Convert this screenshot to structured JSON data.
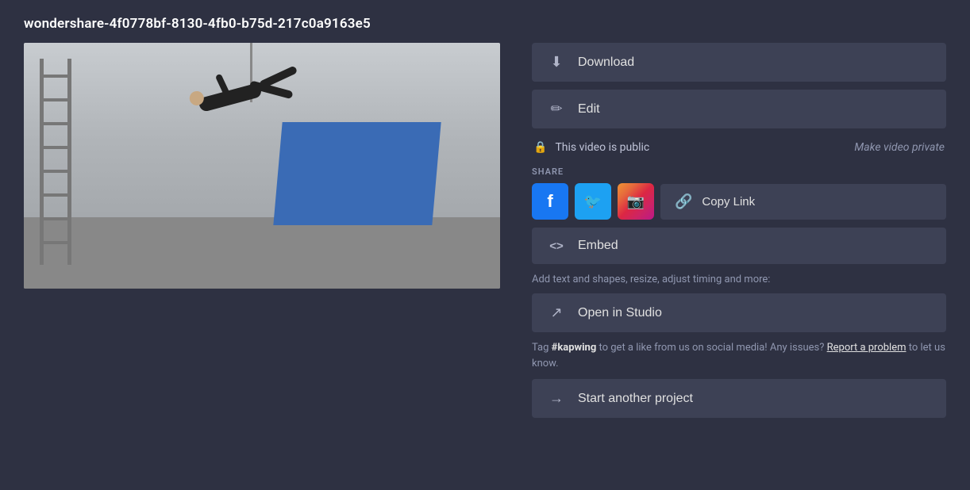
{
  "title": "wondershare-4f0778bf-8130-4fb0-b75d-217c0a9163e5",
  "buttons": {
    "download": "Download",
    "edit": "Edit",
    "embed": "Embed",
    "copy_link": "Copy Link",
    "open_in_studio": "Open in Studio",
    "start_another_project": "Start another project"
  },
  "visibility": {
    "status": "This video is public",
    "make_private": "Make video private"
  },
  "share": {
    "label": "SHARE"
  },
  "studio_desc": "Add text and shapes, resize, adjust timing and more:",
  "tag_text_prefix": "Tag ",
  "tag_hashtag": "#kapwing",
  "tag_text_middle": " to get a like from us on social media! Any issues? ",
  "tag_report_link": "Report a problem",
  "tag_text_suffix": " to let us know.",
  "icons": {
    "download": "⬇",
    "edit": "✏",
    "lock": "🔒",
    "embed": "<>",
    "chain": "🔗",
    "open_external": "↗",
    "arrow_right": "→"
  }
}
